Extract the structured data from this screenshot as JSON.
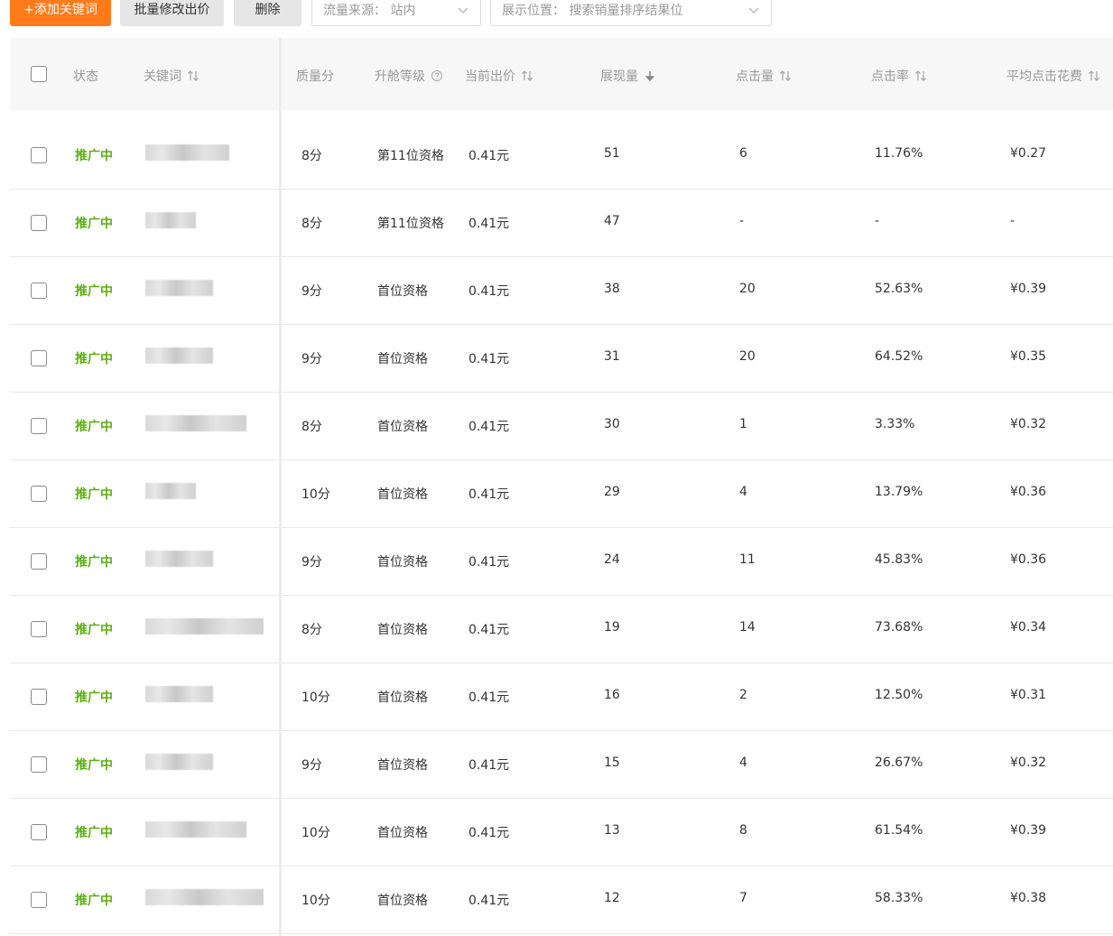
{
  "toolbar": {
    "add_keyword": "+添加关键词",
    "batch_bid": "批量修改出价",
    "delete": "删除",
    "traffic_source": "流量来源： 站内",
    "display_position": "展示位置： 搜索销量排序结果位"
  },
  "table": {
    "headers": {
      "status": "状态",
      "keyword": "关键词",
      "quality": "质量分",
      "rank_level": "升舱等级",
      "current_bid": "当前出价",
      "impressions": "展现量",
      "clicks": "点击量",
      "ctr": "点击率",
      "avg_cpc": "平均点击花费"
    },
    "rows": [
      {
        "status": "推广中",
        "quality": "8分",
        "rank": "第11位资格",
        "bid": "0.41元",
        "impressions": "51",
        "clicks": "6",
        "ctr": "11.76%",
        "cpc": "¥0.27"
      },
      {
        "status": "推广中",
        "quality": "8分",
        "rank": "第11位资格",
        "bid": "0.41元",
        "impressions": "47",
        "clicks": "-",
        "ctr": "-",
        "cpc": "-"
      },
      {
        "status": "推广中",
        "quality": "9分",
        "rank": "首位资格",
        "bid": "0.41元",
        "impressions": "38",
        "clicks": "20",
        "ctr": "52.63%",
        "cpc": "¥0.39"
      },
      {
        "status": "推广中",
        "quality": "9分",
        "rank": "首位资格",
        "bid": "0.41元",
        "impressions": "31",
        "clicks": "20",
        "ctr": "64.52%",
        "cpc": "¥0.35"
      },
      {
        "status": "推广中",
        "quality": "8分",
        "rank": "首位资格",
        "bid": "0.41元",
        "impressions": "30",
        "clicks": "1",
        "ctr": "3.33%",
        "cpc": "¥0.32"
      },
      {
        "status": "推广中",
        "quality": "10分",
        "rank": "首位资格",
        "bid": "0.41元",
        "impressions": "29",
        "clicks": "4",
        "ctr": "13.79%",
        "cpc": "¥0.36"
      },
      {
        "status": "推广中",
        "quality": "9分",
        "rank": "首位资格",
        "bid": "0.41元",
        "impressions": "24",
        "clicks": "11",
        "ctr": "45.83%",
        "cpc": "¥0.36"
      },
      {
        "status": "推广中",
        "quality": "8分",
        "rank": "首位资格",
        "bid": "0.41元",
        "impressions": "19",
        "clicks": "14",
        "ctr": "73.68%",
        "cpc": "¥0.34"
      },
      {
        "status": "推广中",
        "quality": "10分",
        "rank": "首位资格",
        "bid": "0.41元",
        "impressions": "16",
        "clicks": "2",
        "ctr": "12.50%",
        "cpc": "¥0.31"
      },
      {
        "status": "推广中",
        "quality": "9分",
        "rank": "首位资格",
        "bid": "0.41元",
        "impressions": "15",
        "clicks": "4",
        "ctr": "26.67%",
        "cpc": "¥0.32"
      },
      {
        "status": "推广中",
        "quality": "10分",
        "rank": "首位资格",
        "bid": "0.41元",
        "impressions": "13",
        "clicks": "8",
        "ctr": "61.54%",
        "cpc": "¥0.39"
      },
      {
        "status": "推广中",
        "quality": "10分",
        "rank": "首位资格",
        "bid": "0.41元",
        "impressions": "12",
        "clicks": "7",
        "ctr": "58.33%",
        "cpc": "¥0.38"
      }
    ]
  },
  "icons": {
    "sort": "sort-arrows-icon",
    "sort_desc": "arrow-down-icon",
    "help": "help-circle-icon",
    "chevron": "chevron-down-icon"
  },
  "colors": {
    "primary": "#ff7a1a",
    "status_active": "#5eae16",
    "header_bg": "#f7f7f7"
  }
}
